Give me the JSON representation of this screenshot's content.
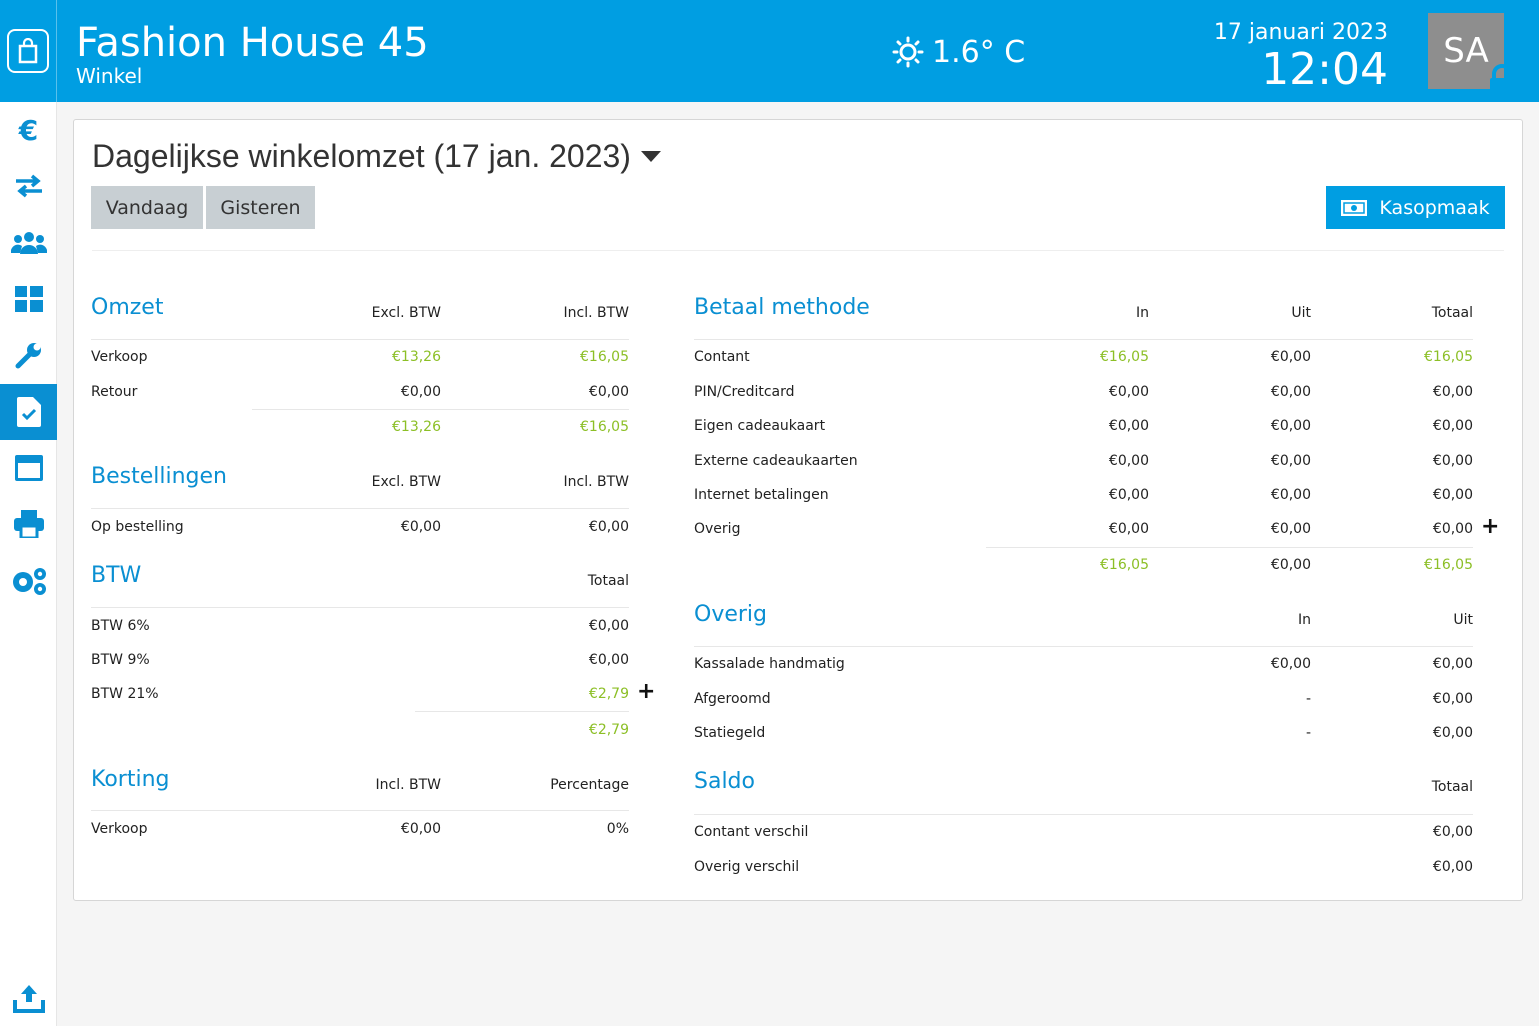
{
  "header": {
    "title": "Fashion House 45",
    "subtitle": "Winkel",
    "weather": "1.6° C",
    "date": "17 januari 2023",
    "time": "12:04",
    "avatar": "SA"
  },
  "sidebar": {
    "items": [
      {
        "icon": "euro-icon",
        "glyph": "€"
      },
      {
        "icon": "transfer-icon"
      },
      {
        "icon": "users-icon"
      },
      {
        "icon": "dashboard-icon"
      },
      {
        "icon": "wrench-icon"
      },
      {
        "icon": "checklist-icon",
        "active": true
      },
      {
        "icon": "window-icon"
      },
      {
        "icon": "printer-icon"
      },
      {
        "icon": "settings-icon"
      },
      {
        "icon": "upload-icon"
      }
    ]
  },
  "page": {
    "title": "Dagelijkse winkelomzet (17 jan. 2023)",
    "btn_today": "Vandaag",
    "btn_yesterday": "Gisteren",
    "btn_kasopmaak": "Kasopmaak"
  },
  "omzet": {
    "title": "Omzet",
    "col1": "Excl. BTW",
    "col2": "Incl. BTW",
    "rows": [
      {
        "label": "Verkoop",
        "excl": "€13,26",
        "incl": "€16,05"
      },
      {
        "label": "Retour",
        "excl": "€0,00",
        "incl": "€0,00"
      }
    ],
    "total_excl": "€13,26",
    "total_incl": "€16,05"
  },
  "bestellingen": {
    "title": "Bestellingen",
    "col1": "Excl. BTW",
    "col2": "Incl. BTW",
    "rows": [
      {
        "label": "Op bestelling",
        "excl": "€0,00",
        "incl": "€0,00"
      }
    ]
  },
  "btw": {
    "title": "BTW",
    "col": "Totaal",
    "rows": [
      {
        "label": "BTW 6%",
        "value": "€0,00"
      },
      {
        "label": "BTW 9%",
        "value": "€0,00"
      },
      {
        "label": "BTW 21%",
        "value": "€2,79"
      }
    ],
    "total": "€2,79"
  },
  "korting": {
    "title": "Korting",
    "col1": "Incl. BTW",
    "col2": "Percentage",
    "rows": [
      {
        "label": "Verkoop",
        "incl": "€0,00",
        "pct": "0%"
      }
    ]
  },
  "betaal": {
    "title": "Betaal methode",
    "col_in": "In",
    "col_uit": "Uit",
    "col_tot": "Totaal",
    "rows": [
      {
        "label": "Contant",
        "in": "€16,05",
        "uit": "€0,00",
        "tot": "€16,05"
      },
      {
        "label": "PIN/Creditcard",
        "in": "€0,00",
        "uit": "€0,00",
        "tot": "€0,00"
      },
      {
        "label": "Eigen cadeaukaart",
        "in": "€0,00",
        "uit": "€0,00",
        "tot": "€0,00"
      },
      {
        "label": "Externe cadeaukaarten",
        "in": "€0,00",
        "uit": "€0,00",
        "tot": "€0,00"
      },
      {
        "label": "Internet betalingen",
        "in": "€0,00",
        "uit": "€0,00",
        "tot": "€0,00"
      },
      {
        "label": "Overig",
        "in": "€0,00",
        "uit": "€0,00",
        "tot": "€0,00"
      }
    ],
    "total_in": "€16,05",
    "total_uit": "€0,00",
    "total_tot": "€16,05"
  },
  "overig": {
    "title": "Overig",
    "col_in": "In",
    "col_uit": "Uit",
    "rows": [
      {
        "label": "Kassalade handmatig",
        "in": "€0,00",
        "uit": "€0,00"
      },
      {
        "label": "Afgeroomd",
        "in": "-",
        "uit": "€0,00"
      },
      {
        "label": "Statiegeld",
        "in": "-",
        "uit": "€0,00"
      }
    ]
  },
  "saldo": {
    "title": "Saldo",
    "col": "Totaal",
    "rows": [
      {
        "label": "Contant verschil",
        "value": "€0,00"
      },
      {
        "label": "Overig verschil",
        "value": "€0,00"
      }
    ]
  },
  "expand_symbol": "+",
  "colors": {
    "brand": "#009ee2",
    "positive": "#8cbf26",
    "button_gray": "#c8cfd3"
  }
}
